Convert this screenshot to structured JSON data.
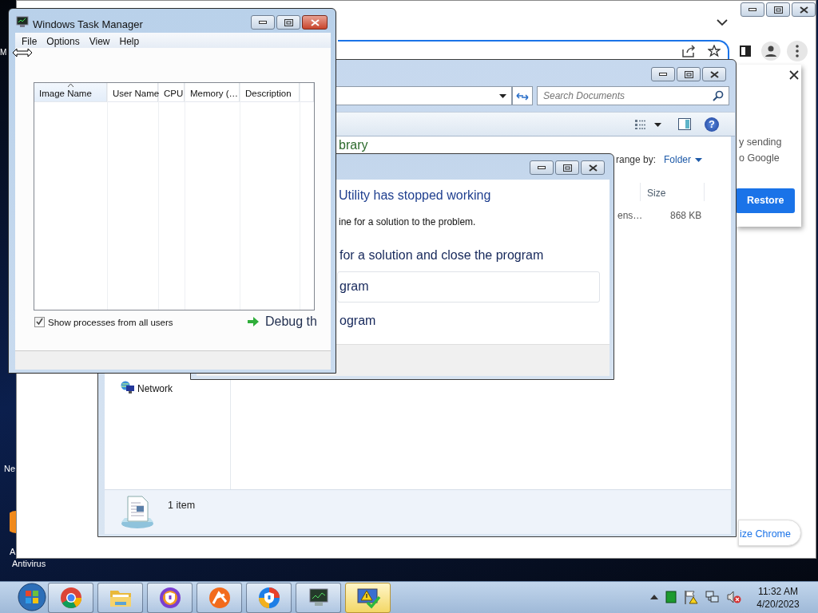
{
  "desktop": {
    "icon_labels": [
      "M",
      "Ne",
      "A",
      "Antivirus"
    ]
  },
  "browser": {
    "popup": {
      "lines": [
        "y sending",
        "o Google"
      ],
      "button": "Restore"
    },
    "customize_button": "ize Chrome"
  },
  "explorer": {
    "search": {
      "placeholder": "Search Documents"
    },
    "help_glyph": "?",
    "library_title": "brary",
    "arrange": {
      "label": "range by:",
      "value": "Folder"
    },
    "columns": [
      "Size"
    ],
    "rows": [
      {
        "name": "ens…",
        "size": "868 KB"
      }
    ],
    "nav_items": [
      "Network"
    ],
    "status": "1 item"
  },
  "error_dialog": {
    "heading": "Utility has stopped working",
    "message": "ine for a solution to the problem.",
    "options": [
      {
        "label": "for a solution and close the program",
        "selected": false
      },
      {
        "label": "gram",
        "selected": true
      },
      {
        "label": "ogram",
        "selected": false
      }
    ]
  },
  "task_manager": {
    "title": "Windows Task Manager",
    "menu": [
      "File",
      "Options",
      "View",
      "Help"
    ],
    "columns": [
      {
        "label": "Image Name",
        "sorted": true
      },
      {
        "label": "User Name",
        "sorted": false
      },
      {
        "label": "CPU",
        "sorted": false
      },
      {
        "label": "Memory (…",
        "sorted": false
      },
      {
        "label": "Description",
        "sorted": false
      }
    ],
    "show_all_users": {
      "label": "Show processes from all users",
      "checked": true
    },
    "debug_label": "Debug th"
  },
  "taskbar": {
    "apps": [
      {
        "kind": "browser",
        "active": false
      },
      {
        "kind": "folder",
        "active": false
      },
      {
        "kind": "shield",
        "active": false
      },
      {
        "kind": "burst",
        "active": false
      },
      {
        "kind": "lock",
        "active": false
      },
      {
        "kind": "monitor",
        "active": false
      },
      {
        "kind": "warning",
        "active": true
      }
    ],
    "clock": {
      "time": "11:32 AM",
      "date": "4/20/2023"
    }
  }
}
